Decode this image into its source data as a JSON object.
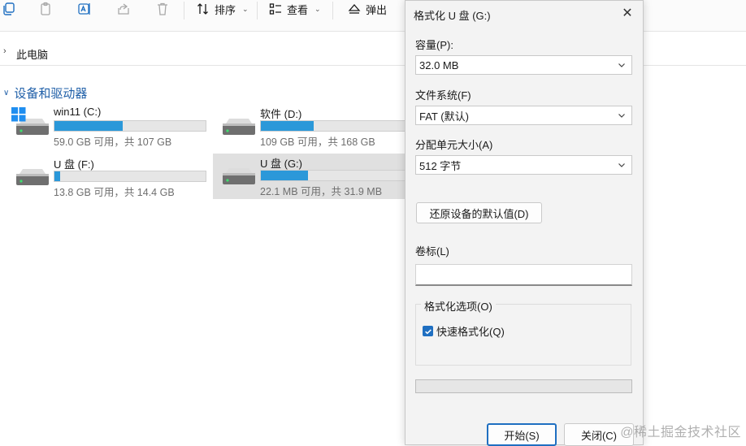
{
  "toolbar": {
    "sort_label": "排序",
    "view_label": "查看",
    "eject_label": "弹出"
  },
  "address": {
    "location": "此电脑"
  },
  "section": {
    "title": "设备和驱动器"
  },
  "drives": [
    {
      "name": "win11 (C:)",
      "info": "59.0 GB 可用，共 107 GB",
      "used_fraction": 0.45
    },
    {
      "name": "软件 (D:)",
      "info": "109 GB 可用，共 168 GB",
      "used_fraction": 0.35
    },
    {
      "name": "U 盘 (F:)",
      "info": "13.8 GB 可用，共 14.4 GB",
      "used_fraction": 0.04
    },
    {
      "name": "U 盘 (G:)",
      "info": "22.1 MB 可用，共 31.9 MB",
      "used_fraction": 0.31
    }
  ],
  "dialog": {
    "title": "格式化 U 盘 (G:)",
    "capacity_label": "容量(P):",
    "capacity_value": "32.0 MB",
    "fs_label": "文件系统(F)",
    "fs_value": "FAT (默认)",
    "alloc_label": "分配单元大小(A)",
    "alloc_value": "512 字节",
    "restore_label": "还原设备的默认值(D)",
    "volume_label": "卷标(L)",
    "volume_value": "",
    "options_title": "格式化选项(O)",
    "quick_format_label": "快速格式化(Q)",
    "quick_format_checked": true,
    "start_label": "开始(S)",
    "close_label": "关闭(C)"
  },
  "watermark": "@稀土掘金技术社区",
  "colors": {
    "accent": "#1f6fc1",
    "usage_bar": "#2b98d9",
    "section_title": "#1f5fa8"
  }
}
